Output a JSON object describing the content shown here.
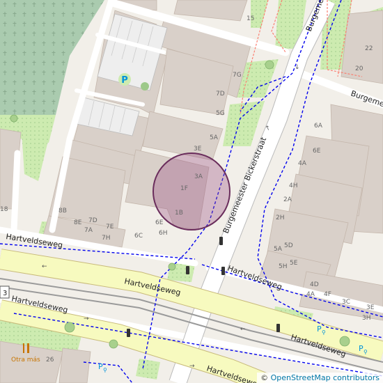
{
  "map": {
    "streets": {
      "bickerstraat": "Burgemeester Bickerstraat",
      "bickerstraat_top": "Burgemees",
      "burgemees_right": "Burgemees",
      "hartveldseweg": "Hartveldseweg"
    },
    "house_numbers": [
      "15",
      "7G",
      "7D",
      "5G",
      "5A",
      "3E",
      "3A",
      "1F",
      "1B",
      "8B",
      "8E",
      "7D",
      "7A",
      "7E",
      "7H",
      "6C",
      "6E",
      "6H",
      "18",
      "20",
      "22",
      "6A",
      "6E",
      "4A",
      "4H",
      "2A",
      "2H",
      "5A",
      "5D",
      "5H",
      "5E",
      "4D",
      "4A",
      "4F",
      "3C",
      "3E",
      "3H",
      "26"
    ],
    "poi": {
      "restaurant": "Otra más",
      "parking": "P"
    },
    "route_shield": "3",
    "marker_circle": "selected location",
    "attribution": {
      "symbol": "©",
      "text": "OpenStreetMap contributors"
    },
    "colors": {
      "background": "#f2efe9",
      "building": "#d9d0c9",
      "grass": "#cdebb0",
      "cemetery": "#aacbaf",
      "primary_road": "#f7fabf",
      "road": "#ffffff",
      "cycleway": "#0000ff",
      "footway": "#fa8072",
      "marker_fill": "#9b4f85",
      "marker_stroke": "#6a2d5c"
    }
  }
}
